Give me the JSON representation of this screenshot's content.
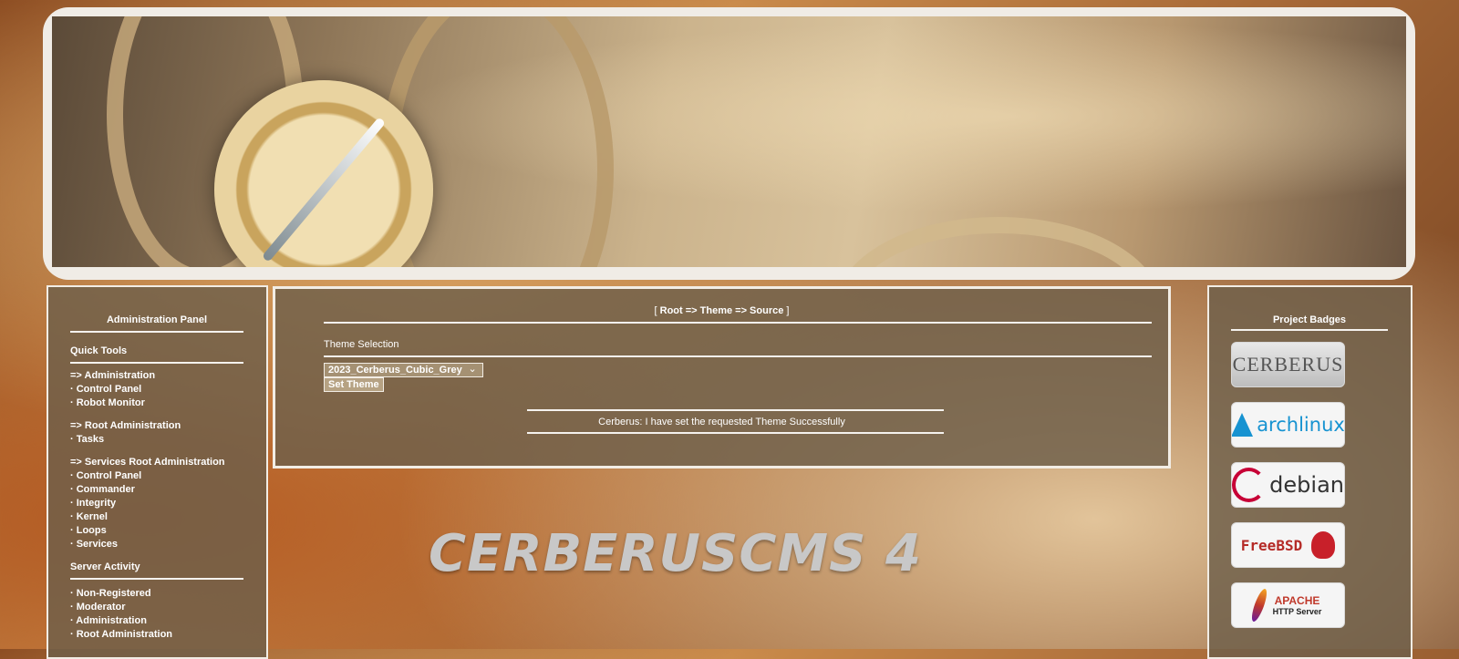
{
  "breadcrumb": {
    "open": "[ ",
    "path": "Root => Theme => Source",
    "close": " ]"
  },
  "left_panel": {
    "title": "Administration Panel",
    "quick_tools_heading": "Quick Tools",
    "groups": [
      {
        "label": "=> Administration",
        "items": [
          "· Control Panel",
          "· Robot Monitor"
        ]
      },
      {
        "label": "=> Root Administration",
        "items": [
          "· Tasks"
        ]
      },
      {
        "label": "=> Services Root Administration",
        "items": [
          "· Control Panel",
          "· Commander",
          "· Integrity",
          "· Kernel",
          "· Loops",
          "· Services"
        ]
      }
    ],
    "server_activity_heading": "Server Activity",
    "server_activity": [
      "· Non-Registered",
      "· Moderator",
      "· Administration",
      "· Root Administration"
    ]
  },
  "theme": {
    "section_label": "Theme Selection",
    "selected": "2023_Cerberus_Cubic_Grey",
    "chevron_icon": "chevron-down-icon",
    "submit_label": "Set Theme"
  },
  "status_message": "Cerberus: I have set the requested Theme Successfully",
  "cms_title": "CERBERUSCMS 4",
  "right_panel": {
    "title": "Project Badges",
    "badges": [
      {
        "name": "CERBERUS"
      },
      {
        "name": "archlinux"
      },
      {
        "name": "debian"
      },
      {
        "name": "FreeBSD"
      },
      {
        "name": "APACHE",
        "sub": "HTTP Server"
      }
    ]
  }
}
